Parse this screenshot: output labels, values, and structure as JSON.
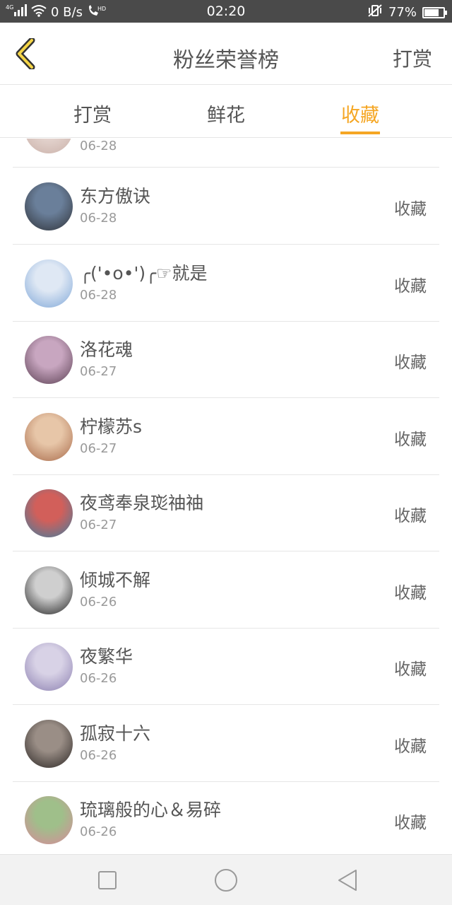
{
  "status_bar": {
    "network": "4G",
    "speed": "0 B/s",
    "hd": "HD",
    "time": "02:20",
    "battery": "77%",
    "battery_level": 0.77
  },
  "header": {
    "title": "粉丝荣誉榜",
    "action": "打赏"
  },
  "tabs": [
    {
      "label": "打赏",
      "active": false
    },
    {
      "label": "鲜花",
      "active": false
    },
    {
      "label": "收藏",
      "active": true
    }
  ],
  "list": {
    "partial_top_date": "06-28",
    "items": [
      {
        "name": "东方傲诀",
        "date": "06-28",
        "action": "收藏",
        "avatar_colors": [
          "#6a7f9a",
          "#2f3238"
        ]
      },
      {
        "name": "╭('•o•')╭☞就是",
        "date": "06-28",
        "action": "收藏",
        "avatar_colors": [
          "#dfe8f4",
          "#7fa7d8"
        ]
      },
      {
        "name": "洛花魂",
        "date": "06-27",
        "action": "收藏",
        "avatar_colors": [
          "#c8a6c0",
          "#5a3f52"
        ]
      },
      {
        "name": "柠檬苏s",
        "date": "06-27",
        "action": "收藏",
        "avatar_colors": [
          "#e7c6a8",
          "#a86a4a"
        ]
      },
      {
        "name": "夜鸢奉泉珳䄂䄂",
        "date": "06-27",
        "action": "收藏",
        "avatar_colors": [
          "#d25f5a",
          "#3f7ea0"
        ]
      },
      {
        "name": "倾城不解",
        "date": "06-26",
        "action": "收藏",
        "avatar_colors": [
          "#cfcfcf",
          "#222222"
        ]
      },
      {
        "name": "夜繁华",
        "date": "06-26",
        "action": "收藏",
        "avatar_colors": [
          "#d8d2e6",
          "#8b7fb0"
        ]
      },
      {
        "name": "孤寂十六",
        "date": "06-26",
        "action": "收藏",
        "avatar_colors": [
          "#9a8e86",
          "#2b2624"
        ]
      },
      {
        "name": "琉璃般的心＆易碎",
        "date": "06-26",
        "action": "收藏",
        "avatar_colors": [
          "#9fbf8a",
          "#d88a9a"
        ]
      }
    ]
  },
  "colors": {
    "accent": "#f5a623",
    "text": "#555555",
    "subtext": "#9a9a9a",
    "divider": "#e6e6e6"
  }
}
